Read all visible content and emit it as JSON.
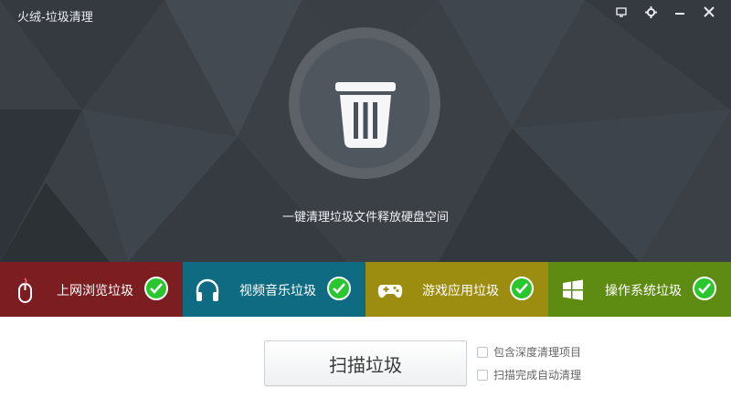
{
  "window": {
    "title": "火绒-垃圾清理"
  },
  "controls": {
    "monitor_icon": "monitor-icon",
    "settings_icon": "gear-icon",
    "minimize_icon": "minimize-icon",
    "close_icon": "close-icon"
  },
  "hero": {
    "hint": "一键清理垃圾文件释放硬盘空间",
    "icon": "trash-icon"
  },
  "tiles": [
    {
      "label": "上网浏览垃圾",
      "icon": "mouse-icon",
      "color": "#7b1d21",
      "checked": true
    },
    {
      "label": "视频音乐垃圾",
      "icon": "headphones-icon",
      "color": "#0e6b82",
      "checked": true
    },
    {
      "label": "游戏应用垃圾",
      "icon": "gamepad-icon",
      "color": "#9c8d10",
      "checked": true
    },
    {
      "label": "操作系统垃圾",
      "icon": "windows-icon",
      "color": "#5e8b12",
      "checked": true
    }
  ],
  "actions": {
    "scan_label": "扫描垃圾"
  },
  "options": [
    {
      "label": "包含深度清理项目",
      "checked": false
    },
    {
      "label": "扫描完成自动清理",
      "checked": false
    }
  ],
  "colors": {
    "hero_bg": "#3b4047",
    "check": "#29c62d"
  }
}
